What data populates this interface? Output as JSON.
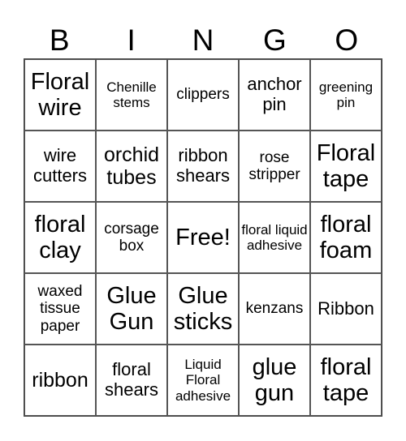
{
  "header": {
    "letters": [
      "B",
      "I",
      "N",
      "G",
      "O"
    ]
  },
  "cells": [
    {
      "text": "Floral wire",
      "size": "s-xl"
    },
    {
      "text": "Chenille stems",
      "size": "s-xs"
    },
    {
      "text": "clippers",
      "size": "s-s"
    },
    {
      "text": "anchor pin",
      "size": "s-m"
    },
    {
      "text": "greening pin",
      "size": "s-xs"
    },
    {
      "text": "wire cutters",
      "size": "s-m"
    },
    {
      "text": "orchid tubes",
      "size": "s-l"
    },
    {
      "text": "ribbon shears",
      "size": "s-m"
    },
    {
      "text": "rose stripper",
      "size": "s-s"
    },
    {
      "text": "Floral tape",
      "size": "s-xl"
    },
    {
      "text": "floral clay",
      "size": "s-xl"
    },
    {
      "text": "corsage box",
      "size": "s-s"
    },
    {
      "text": "Free!",
      "size": "s-xl"
    },
    {
      "text": "floral liquid adhesive",
      "size": "s-xs"
    },
    {
      "text": "floral foam",
      "size": "s-xl"
    },
    {
      "text": "waxed tissue paper",
      "size": "s-s"
    },
    {
      "text": "Glue Gun",
      "size": "s-xl"
    },
    {
      "text": "Glue sticks",
      "size": "s-xl"
    },
    {
      "text": "kenzans",
      "size": "s-s"
    },
    {
      "text": "Ribbon",
      "size": "s-m"
    },
    {
      "text": "ribbon",
      "size": "s-l"
    },
    {
      "text": "floral shears",
      "size": "s-m"
    },
    {
      "text": "Liquid Floral adhesive",
      "size": "s-xs"
    },
    {
      "text": "glue gun",
      "size": "s-xl"
    },
    {
      "text": "floral tape",
      "size": "s-xl"
    }
  ]
}
